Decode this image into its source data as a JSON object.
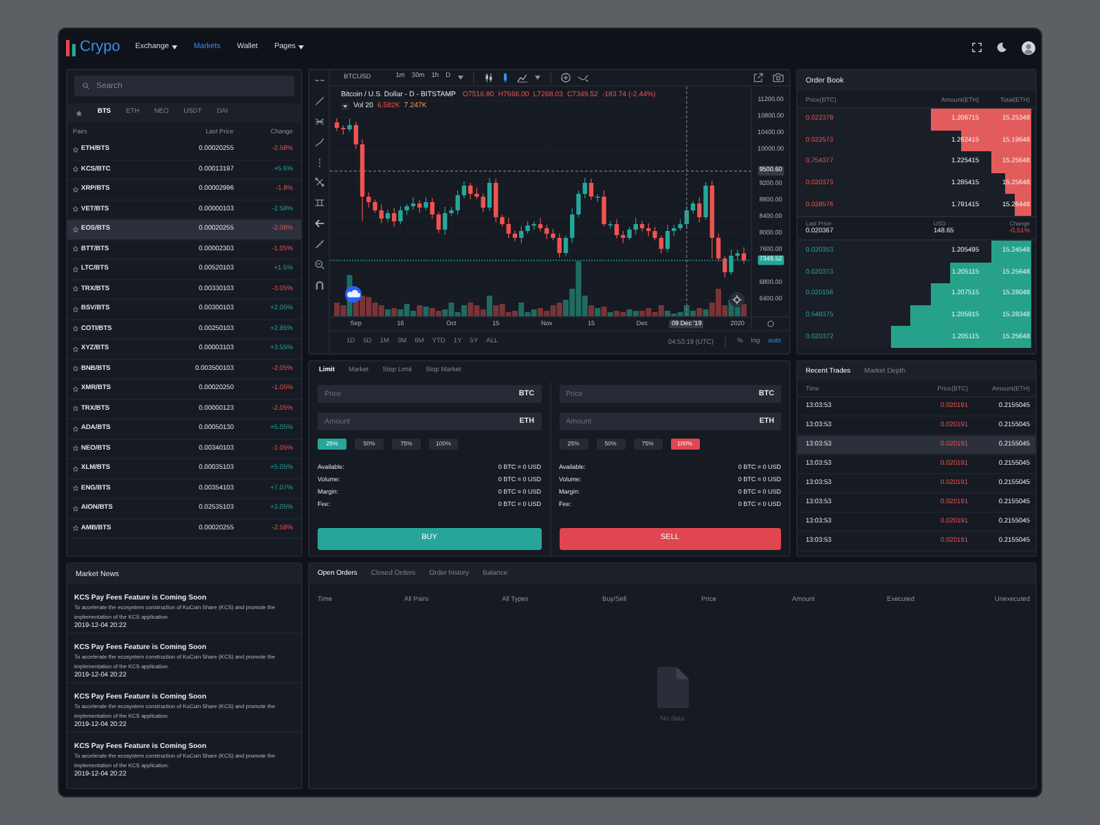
{
  "header": {
    "logo": "Crypo",
    "nav": [
      {
        "label": "Exchange",
        "dropdown": true,
        "selected": false
      },
      {
        "label": "Markets",
        "dropdown": false,
        "selected": true
      },
      {
        "label": "Wallet",
        "dropdown": false,
        "selected": false
      },
      {
        "label": "Pages",
        "dropdown": true,
        "selected": false
      }
    ]
  },
  "markets": {
    "search": {
      "placeholder": "Search"
    },
    "tabs": [
      {
        "label": "BTS",
        "selected": true
      },
      {
        "label": "ETH",
        "selected": false
      },
      {
        "label": "NEO",
        "selected": false
      },
      {
        "label": "USDT",
        "selected": false
      },
      {
        "label": "DAI",
        "selected": false
      }
    ],
    "columns": [
      "Pairs",
      "Last Price",
      "Change"
    ],
    "rows": [
      {
        "pair": "ETH/BTS",
        "price": "0.00020255",
        "change": "-2.58%",
        "rising": false,
        "selected": false
      },
      {
        "pair": "KCS/BTC",
        "price": "0.00013197",
        "change": "+5.6%",
        "rising": true,
        "selected": false
      },
      {
        "pair": "XRP/BTS",
        "price": "0.00002996",
        "change": "-1.8%",
        "rising": false,
        "selected": false
      },
      {
        "pair": "VET/BTS",
        "price": "0.00000103",
        "change": "-2.58%",
        "rising": true,
        "selected": false
      },
      {
        "pair": "EOS/BTS",
        "price": "0.00020255",
        "change": "-2.08%",
        "rising": false,
        "selected": true
      },
      {
        "pair": "BTT/BTS",
        "price": "0.00002303",
        "change": "-1.05%",
        "rising": false,
        "selected": false
      },
      {
        "pair": "LTC/BTS",
        "price": "0.00520103",
        "change": "+1.5%",
        "rising": true,
        "selected": false
      },
      {
        "pair": "TRX/BTS",
        "price": "0.00330103",
        "change": "-3.05%",
        "rising": false,
        "selected": false
      },
      {
        "pair": "BSV/BTS",
        "price": "0.00300103",
        "change": "+2.05%",
        "rising": true,
        "selected": false
      },
      {
        "pair": "COTI/BTS",
        "price": "0.00250103",
        "change": "+2.85%",
        "rising": true,
        "selected": false
      },
      {
        "pair": "XYZ/BTS",
        "price": "0.00003103",
        "change": "+3.55%",
        "rising": true,
        "selected": false
      },
      {
        "pair": "BNB/BTS",
        "price": "0.003500103",
        "change": "-2.05%",
        "rising": false,
        "selected": false
      },
      {
        "pair": "XMR/BTS",
        "price": "0.00020250",
        "change": "-1.05%",
        "rising": false,
        "selected": false
      },
      {
        "pair": "TRX/BTS",
        "price": "0.00000123",
        "change": "-2.05%",
        "rising": false,
        "selected": false
      },
      {
        "pair": "ADA/BTS",
        "price": "0.00050130",
        "change": "+5.05%",
        "rising": true,
        "selected": false
      },
      {
        "pair": "NEO/BTS",
        "price": "0.00340103",
        "change": "-1.05%",
        "rising": false,
        "selected": false
      },
      {
        "pair": "XLM/BTS",
        "price": "0.00035103",
        "change": "+5.05%",
        "rising": true,
        "selected": false
      },
      {
        "pair": "ENG/BTS",
        "price": "0.00354103",
        "change": "+7.07%",
        "rising": true,
        "selected": false
      },
      {
        "pair": "AION/BTS",
        "price": "0.02535103",
        "change": "+3.05%",
        "rising": true,
        "selected": false
      },
      {
        "pair": "AMB/BTS",
        "price": "0.00020255",
        "change": "-2.58%",
        "rising": false,
        "selected": false
      }
    ]
  },
  "chart": {
    "symbol": "BTCUSD",
    "intervals": [
      "1m",
      "30m",
      "1h",
      "D"
    ],
    "legend": {
      "title": "Bitcoin / U.S. Dollar - D - BITSTAMP",
      "values": [
        "O7516.80",
        "H7666.00",
        "L7268.03",
        "C7349.52",
        "-183.74 (-2.44%)"
      ],
      "volume_label": "Vol 20",
      "volume_values": [
        {
          "kind": "volume",
          "text": "6.582K"
        },
        {
          "kind": "average",
          "text": "7.247K"
        }
      ]
    },
    "chart_data": {
      "type": "candlestick",
      "categories": [
        null,
        null,
        null,
        "Sep",
        null,
        null,
        null,
        null,
        null,
        null,
        "16",
        null,
        null,
        null,
        null,
        null,
        null,
        null,
        "Oct",
        null,
        null,
        null,
        null,
        null,
        null,
        "15",
        null,
        null,
        null,
        null,
        null,
        null,
        null,
        "Nov",
        null,
        null,
        null,
        null,
        null,
        null,
        "15",
        null,
        null,
        null,
        null,
        null,
        null,
        null,
        "Dec",
        null,
        null,
        null,
        null,
        null,
        null,
        "09 Dec '19",
        null,
        null,
        null,
        null,
        null,
        null,
        null,
        "2020",
        null
      ],
      "ohlc": [
        [
          10678,
          10778,
          10465,
          10545
        ],
        [
          10545,
          10605,
          10382,
          10512
        ],
        [
          10512,
          10761,
          10452,
          10611
        ],
        [
          10611,
          10691,
          10037,
          10147
        ],
        [
          10147,
          10267,
          8300,
          8886
        ],
        [
          8886,
          8986,
          8624,
          8754
        ],
        [
          8754,
          8814,
          8495,
          8555
        ],
        [
          8555,
          8705,
          8246,
          8356
        ],
        [
          8356,
          8568,
          8276,
          8488
        ],
        [
          8488,
          8608,
          8159,
          8289
        ],
        [
          8289,
          8655,
          8229,
          8555
        ],
        [
          8555,
          8714,
          8445,
          8654
        ],
        [
          8654,
          8871,
          8574,
          8721
        ],
        [
          8721,
          8801,
          8491,
          8621
        ],
        [
          8621,
          8874,
          8561,
          8754
        ],
        [
          8754,
          8854,
          8345,
          8455
        ],
        [
          8455,
          8515,
          8010,
          8090
        ],
        [
          8090,
          8638,
          7960,
          8488
        ],
        [
          8488,
          8635,
          8428,
          8555
        ],
        [
          8555,
          9040,
          8445,
          8920
        ],
        [
          8920,
          9252,
          8840,
          9152
        ],
        [
          9152,
          9212,
          8823,
          8953
        ],
        [
          8953,
          9103,
          8826,
          8886
        ],
        [
          8886,
          8966,
          8511,
          8621
        ],
        [
          8621,
          9338,
          8541,
          9218
        ],
        [
          9218,
          9318,
          8259,
          8389
        ],
        [
          8389,
          8449,
          8163,
          8223
        ],
        [
          8223,
          8373,
          7881,
          7991
        ],
        [
          7991,
          8071,
          7811,
          7891
        ],
        [
          7891,
          8177,
          7761,
          8057
        ],
        [
          8057,
          8290,
          7997,
          8190
        ],
        [
          8190,
          8283,
          8080,
          8223
        ],
        [
          8223,
          8373,
          8044,
          8124
        ],
        [
          8124,
          8204,
          7861,
          7991
        ],
        [
          7991,
          8111,
          7831,
          7891
        ],
        [
          7891,
          7991,
          7416,
          7526
        ],
        [
          7526,
          7951,
          7446,
          7891
        ],
        [
          7891,
          8605,
          7761,
          8455
        ],
        [
          8455,
          9033,
          8395,
          8953
        ],
        [
          8953,
          9338,
          8843,
          9218
        ],
        [
          9218,
          9318,
          8806,
          8886
        ],
        [
          8886,
          8946,
          8756,
          8886
        ],
        [
          8886,
          9036,
          8163,
          8223
        ],
        [
          8223,
          8303,
          8113,
          8223
        ],
        [
          8223,
          8343,
          7878,
          7958
        ],
        [
          7958,
          8058,
          7761,
          7891
        ],
        [
          7891,
          8150,
          7831,
          8090
        ],
        [
          8090,
          8373,
          7980,
          8223
        ],
        [
          8223,
          8303,
          8044,
          8124
        ],
        [
          8124,
          8244,
          7927,
          8057
        ],
        [
          8057,
          8157,
          7831,
          7891
        ],
        [
          7891,
          7951,
          7516,
          7626
        ],
        [
          7626,
          8207,
          7546,
          8057
        ],
        [
          8057,
          8204,
          7927,
          8124
        ],
        [
          8124,
          8343,
          8064,
          8223
        ],
        [
          8223,
          8655,
          8113,
          8555
        ],
        [
          8555,
          8781,
          8475,
          8721
        ],
        [
          8721,
          8871,
          8259,
          8389
        ],
        [
          8389,
          9232,
          8329,
          9152
        ],
        [
          9152,
          9272,
          7391,
          7891
        ],
        [
          7891,
          7991,
          7314,
          7394
        ],
        [
          7394,
          7454,
          6932,
          7062
        ],
        [
          7062,
          7610,
          7002,
          7460
        ],
        [
          7460,
          7597,
          7350,
          7516.8
        ],
        [
          7516.8,
          7666,
          7268.03,
          7349.52
        ]
      ],
      "ylim": [
        6000,
        11540
      ],
      "yticks": [
        {
          "value": 11200,
          "label": "11200.00"
        },
        {
          "value": 10800,
          "label": "10800.00"
        },
        {
          "value": 10400,
          "label": "10400.00"
        },
        {
          "value": 10000,
          "label": "10000.00"
        },
        {
          "value": 9200,
          "label": "9200.00"
        },
        {
          "value": 8800,
          "label": "8800.00"
        },
        {
          "value": 8400,
          "label": "8400.00"
        },
        {
          "value": 8000,
          "label": "8000.00"
        },
        {
          "value": 7600,
          "label": "7600.00"
        },
        {
          "value": 6800,
          "label": "6800.00"
        },
        {
          "value": 6400,
          "label": "6400.00"
        }
      ],
      "grid": true,
      "ref_lines": [
        {
          "axis": "y",
          "value": 9500.6,
          "label": "9500.60"
        },
        {
          "axis": "y",
          "value": 7349.52,
          "label": "7349.52",
          "color": "#26a69a"
        },
        {
          "axis": "x",
          "value": "09 Dec '19"
        }
      ]
    },
    "ranges": [
      "1D",
      "5D",
      "1M",
      "3M",
      "6M",
      "YTD",
      "1Y",
      "5Y",
      "ALL"
    ],
    "clock": "04:53:19 (UTC)",
    "scale_options": [
      {
        "label": "%",
        "selected": false
      },
      {
        "label": "log",
        "selected": false
      },
      {
        "label": "auto",
        "selected": true
      }
    ]
  },
  "order_book": {
    "title": "Order Book",
    "columns": [
      "Price(BTC)",
      "Amount(ETH)",
      "Total(ETH)"
    ],
    "asks": [
      {
        "price": "0.022378",
        "amount": "1.206715",
        "total": "15.25348",
        "level": 0.43
      },
      {
        "price": "0.022573",
        "amount": "1.262415",
        "total": "15.19648",
        "level": 0.3
      },
      {
        "price": "0.754377",
        "amount": "1.225415",
        "total": "15.25648",
        "level": 0.17
      },
      {
        "price": "0.020373",
        "amount": "1.285415",
        "total": "15.25648",
        "level": 0.11
      },
      {
        "price": "0.028576",
        "amount": "1.791415",
        "total": "15.26448",
        "level": 0.07
      }
    ],
    "summary": {
      "last_price_label": "Last Price",
      "last_price": "0.020367",
      "usd_label": "USD",
      "usd": "148.65",
      "change_label": "Change",
      "change": "-0.51%",
      "change_rising": false
    },
    "bids": [
      {
        "price": "0.020353",
        "amount": "1.205495",
        "total": "15.24548",
        "level": 0.17
      },
      {
        "price": "0.020373",
        "amount": "1.205115",
        "total": "15.25648",
        "level": 0.35
      },
      {
        "price": "0.020156",
        "amount": "1.207515",
        "total": "15.28048",
        "level": 0.43
      },
      {
        "price": "0.548375",
        "amount": "1.205915",
        "total": "15.28348",
        "level": 0.52
      },
      {
        "price": "0.020372",
        "amount": "1.205115",
        "total": "15.25648",
        "level": 0.6
      }
    ]
  },
  "trades": {
    "tabs": [
      {
        "label": "Recent Trades",
        "selected": true
      },
      {
        "label": "Market Depth",
        "selected": false
      }
    ],
    "columns": [
      "Time",
      "Price(BTC)",
      "Amount(ETH)"
    ],
    "rows": [
      {
        "time": "13:03:53",
        "price": "0.020191",
        "amount": "0.2155045",
        "buy": false,
        "selected": false
      },
      {
        "time": "13:03:53",
        "price": "0.020191",
        "amount": "0.2155045",
        "buy": false,
        "selected": false
      },
      {
        "time": "13:03:53",
        "price": "0.020191",
        "amount": "0.2155045",
        "buy": false,
        "selected": true
      },
      {
        "time": "13:03:53",
        "price": "0.020191",
        "amount": "0.2155045",
        "buy": false,
        "selected": false
      },
      {
        "time": "13:03:53",
        "price": "0.020191",
        "amount": "0.2155045",
        "buy": false,
        "selected": false
      },
      {
        "time": "13:03:53",
        "price": "0.020191",
        "amount": "0.2155045",
        "buy": false,
        "selected": false
      },
      {
        "time": "13:03:53",
        "price": "0.020191",
        "amount": "0.2155045",
        "buy": false,
        "selected": false
      },
      {
        "time": "13:03:53",
        "price": "0.020191",
        "amount": "0.2155045",
        "buy": false,
        "selected": false
      }
    ]
  },
  "order_form": {
    "tabs": [
      {
        "label": "Limit",
        "selected": true
      },
      {
        "label": "Market",
        "selected": false
      },
      {
        "label": "Stop Limit",
        "selected": false
      },
      {
        "label": "Stop Market",
        "selected": false
      }
    ],
    "sides": [
      {
        "kind": "buy",
        "price": {
          "placeholder": "Price",
          "unit": "BTC"
        },
        "amount": {
          "placeholder": "Amount",
          "unit": "ETH"
        },
        "percents": [
          {
            "label": "25%",
            "selected": true
          },
          {
            "label": "50%",
            "selected": false
          },
          {
            "label": "75%",
            "selected": false
          },
          {
            "label": "100%",
            "selected": false
          }
        ],
        "info": [
          {
            "label": "Available:",
            "value": "0 BTC = 0 USD"
          },
          {
            "label": "Volume:",
            "value": "0 BTC = 0 USD"
          },
          {
            "label": "Margin:",
            "value": "0 BTC = 0 USD"
          },
          {
            "label": "Fee:",
            "value": "0 BTC = 0 USD"
          }
        ],
        "button": "BUY"
      },
      {
        "kind": "sell",
        "price": {
          "placeholder": "Price",
          "unit": "BTC"
        },
        "amount": {
          "placeholder": "Amount",
          "unit": "ETH"
        },
        "percents": [
          {
            "label": "25%",
            "selected": false
          },
          {
            "label": "50%",
            "selected": false
          },
          {
            "label": "75%",
            "selected": false
          },
          {
            "label": "100%",
            "selected": true
          }
        ],
        "info": [
          {
            "label": "Available:",
            "value": "0 BTC = 0 USD"
          },
          {
            "label": "Volume:",
            "value": "0 BTC = 0 USD"
          },
          {
            "label": "Margin:",
            "value": "0 BTC = 0 USD"
          },
          {
            "label": "Fee:",
            "value": "0 BTC = 0 USD"
          }
        ],
        "button": "SELL"
      }
    ]
  },
  "news": {
    "title": "Market News",
    "items": [
      {
        "title": "KCS Pay Fees Feature is Coming Soon",
        "body": "To accelerate the ecosystem construction of KuCoin Share (KCS) and promote the implementation of the KCS application.",
        "date": "2019-12-04 20:22"
      },
      {
        "title": "KCS Pay Fees Feature is Coming Soon",
        "body": "To accelerate the ecosystem construction of KuCoin Share (KCS) and promote the implementation of the KCS application.",
        "date": "2019-12-04 20:22"
      },
      {
        "title": "KCS Pay Fees Feature is Coming Soon",
        "body": "To accelerate the ecosystem construction of KuCoin Share (KCS) and promote the implementation of the KCS application.",
        "date": "2019-12-04 20:22"
      },
      {
        "title": "KCS Pay Fees Feature is Coming Soon",
        "body": "To accelerate the ecosystem construction of KuCoin Share (KCS) and promote the implementation of the KCS application.",
        "date": "2019-12-04 20:22"
      }
    ]
  },
  "orders": {
    "tabs": [
      {
        "label": "Open Orders",
        "selected": true
      },
      {
        "label": "Closed Orders",
        "selected": false
      },
      {
        "label": "Order history",
        "selected": false
      },
      {
        "label": "Balance",
        "selected": false
      }
    ],
    "columns": [
      "Time",
      "All Pairs",
      "All Types",
      "Buy/Sell",
      "Price",
      "Amount",
      "Executed",
      "Unexecuted"
    ],
    "empty": "No data"
  }
}
